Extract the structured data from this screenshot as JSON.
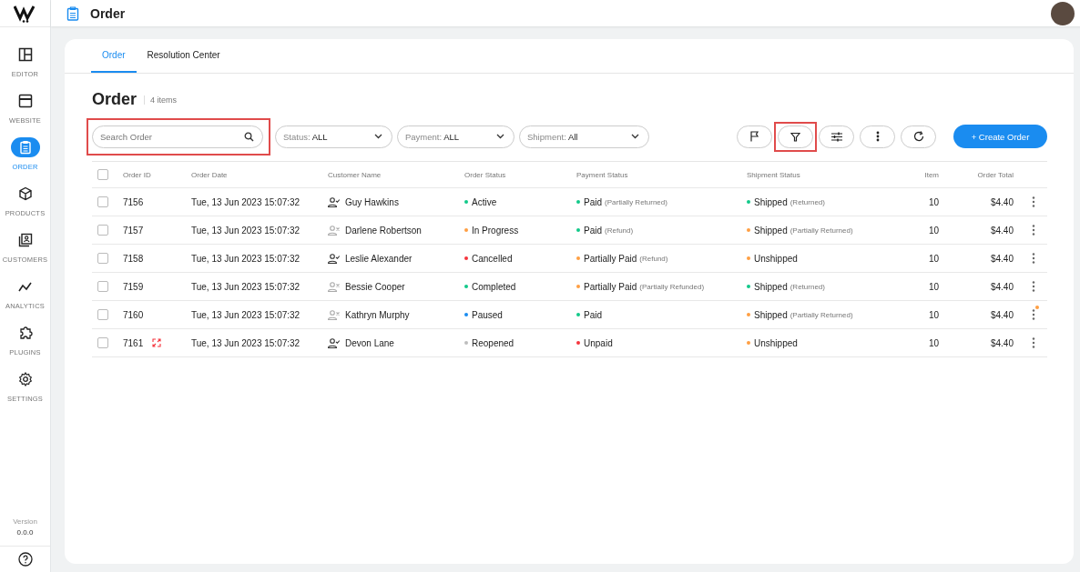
{
  "topbar": {
    "title": "Order"
  },
  "sidebar": {
    "items": [
      {
        "label": "EDITOR",
        "selected": false
      },
      {
        "label": "WEBSITE",
        "selected": false
      },
      {
        "label": "ORDER",
        "selected": true
      },
      {
        "label": "PRODUCTS",
        "selected": false
      },
      {
        "label": "CUSTOMERS",
        "selected": false
      },
      {
        "label": "ANALYTICS",
        "selected": false
      },
      {
        "label": "PLUGINS",
        "selected": false
      },
      {
        "label": "SETTINGS",
        "selected": false
      }
    ],
    "version_label": "Version",
    "version": "0.0.0"
  },
  "tabs": [
    {
      "label": "Order",
      "selected": true
    },
    {
      "label": "Resolution Center",
      "selected": false
    }
  ],
  "heading": {
    "title": "Order",
    "count": "4 items"
  },
  "search": {
    "placeholder": "Search Order",
    "highlighted": true
  },
  "filters": [
    {
      "label": "Status:",
      "value": "ALL"
    },
    {
      "label": "Payment:",
      "value": "ALL"
    },
    {
      "label": "Shipment:",
      "value": "All"
    }
  ],
  "toolbar": [
    {
      "kind": "flag",
      "highlighted": false
    },
    {
      "kind": "filter",
      "highlighted": true
    },
    {
      "kind": "sliders",
      "highlighted": false
    },
    {
      "kind": "more",
      "highlighted": false
    },
    {
      "kind": "refresh",
      "highlighted": false
    }
  ],
  "create_button": "+ Create Order",
  "table": {
    "all_checked": false,
    "columns": [
      "Order ID",
      "Order Date",
      "Customer Name",
      "Order Status",
      "Payment Status",
      "Shipment Status",
      "Item",
      "Order Total"
    ],
    "rows": [
      {
        "checked": false,
        "id": "7156",
        "flagged": false,
        "date": "Tue, 13 Jun 2023 15:07:32",
        "customer": "Guy Hawkins",
        "verified": true,
        "order_status": {
          "text": "Active",
          "color": "#12c98a"
        },
        "payment": {
          "text": "Paid",
          "note": "(Partially Returned)",
          "color": "#12c98a"
        },
        "shipment": {
          "text": "Shipped",
          "note": "(Returned)",
          "color": "#12c98a"
        },
        "item": "10",
        "total": "$4.40",
        "notification": false
      },
      {
        "checked": false,
        "id": "7157",
        "flagged": false,
        "date": "Tue, 13 Jun 2023 15:07:32",
        "customer": "Darlene Robertson",
        "verified": false,
        "order_status": {
          "text": "In Progress",
          "color": "#ff9f43"
        },
        "payment": {
          "text": "Paid",
          "note": "(Refund)",
          "color": "#12c98a"
        },
        "shipment": {
          "text": "Shipped",
          "note": "(Partially Returned)",
          "color": "#ff9f43"
        },
        "item": "10",
        "total": "$4.40",
        "notification": false
      },
      {
        "checked": false,
        "id": "7158",
        "flagged": false,
        "date": "Tue, 13 Jun 2023 15:07:32",
        "customer": "Leslie Alexander",
        "verified": true,
        "order_status": {
          "text": "Cancelled",
          "color": "#f5343d"
        },
        "payment": {
          "text": "Partially Paid",
          "note": "(Refund)",
          "color": "#ff9f43"
        },
        "shipment": {
          "text": "Unshipped",
          "color": "#ff9f43"
        },
        "item": "10",
        "total": "$4.40",
        "notification": false
      },
      {
        "checked": false,
        "id": "7159",
        "flagged": false,
        "date": "Tue, 13 Jun 2023 15:07:32",
        "customer": "Bessie Cooper",
        "verified": false,
        "order_status": {
          "text": "Completed",
          "color": "#12c98a"
        },
        "payment": {
          "text": "Partially Paid",
          "note": "(Partially Refunded)",
          "color": "#ff9f43"
        },
        "shipment": {
          "text": "Shipped",
          "note": "(Returned)",
          "color": "#12c98a"
        },
        "item": "10",
        "total": "$4.40",
        "notification": false
      },
      {
        "checked": false,
        "id": "7160",
        "flagged": false,
        "date": "Tue, 13 Jun 2023 15:07:32",
        "customer": "Kathryn Murphy",
        "verified": false,
        "order_status": {
          "text": "Paused",
          "color": "#1a8cf0"
        },
        "payment": {
          "text": "Paid",
          "color": "#12c98a"
        },
        "shipment": {
          "text": "Shipped",
          "note": "(Partially Returned)",
          "color": "#ff9f43"
        },
        "item": "10",
        "total": "$4.40",
        "notification": true
      },
      {
        "checked": false,
        "id": "7161",
        "flagged": true,
        "date": "Tue, 13 Jun 2023 15:07:32",
        "customer": "Devon Lane",
        "verified": true,
        "order_status": {
          "text": "Reopened",
          "color": "#bdbdbd"
        },
        "payment": {
          "text": "Unpaid",
          "color": "#f5343d"
        },
        "shipment": {
          "text": "Unshipped",
          "color": "#ff9f43"
        },
        "item": "10",
        "total": "$4.40",
        "notification": false
      }
    ]
  }
}
